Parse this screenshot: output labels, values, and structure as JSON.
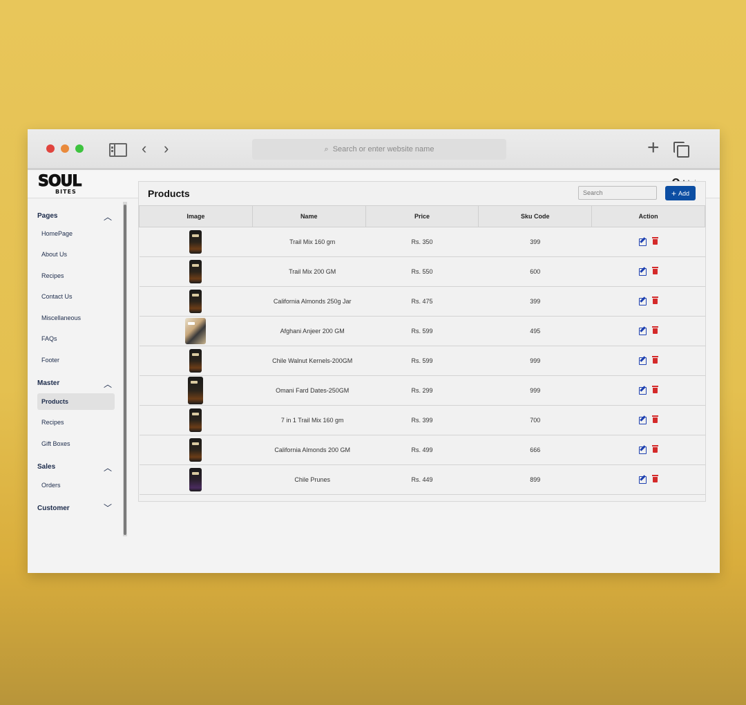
{
  "browser": {
    "url_placeholder": "Search or enter website name"
  },
  "header": {
    "logo_text": "SOUL BITES",
    "user_label": "Admin"
  },
  "sidebar": {
    "sections": [
      {
        "title": "Pages",
        "expanded": true,
        "items": [
          "HomePage",
          "About Us",
          "Recipes",
          "Contact Us",
          "Miscellaneous",
          "FAQs",
          "Footer"
        ]
      },
      {
        "title": "Master",
        "expanded": true,
        "items": [
          "Products",
          "Recipes",
          "Gift Boxes"
        ],
        "active": "Products"
      },
      {
        "title": "Sales",
        "expanded": true,
        "items": [
          "Orders"
        ]
      },
      {
        "title": "Customer",
        "expanded": false,
        "items": []
      }
    ]
  },
  "main": {
    "title": "Products",
    "search_placeholder": "Search",
    "add_label": "Add",
    "columns": [
      "Image",
      "Name",
      "Price",
      "Sku Code",
      "Action"
    ],
    "rows": [
      {
        "name": "Trail Mix 160 gm",
        "price": "Rs. 350",
        "sku": "399",
        "thumb": "dark"
      },
      {
        "name": "Trail Mix 200 GM",
        "price": "Rs. 550",
        "sku": "600",
        "thumb": "dark"
      },
      {
        "name": "California Almonds 250g Jar",
        "price": "Rs. 475",
        "sku": "399",
        "thumb": "dark"
      },
      {
        "name": "Afghani Anjeer 200 GM",
        "price": "Rs. 599",
        "sku": "495",
        "thumb": "light"
      },
      {
        "name": "Chile Walnut Kernels-200GM",
        "price": "Rs. 599",
        "sku": "999",
        "thumb": "dark"
      },
      {
        "name": "Omani Fard Dates-250GM",
        "price": "Rs. 299",
        "sku": "999",
        "thumb": "dark"
      },
      {
        "name": "7 in 1 Trail Mix 160 gm",
        "price": "Rs. 399",
        "sku": "700",
        "thumb": "dark"
      },
      {
        "name": "California Almonds 200 GM",
        "price": "Rs. 499",
        "sku": "666",
        "thumb": "dark"
      },
      {
        "name": "Chile Prunes",
        "price": "Rs. 449",
        "sku": "899",
        "thumb": "purple"
      }
    ]
  },
  "colors": {
    "accent": "#0c4ea3",
    "edit": "#1c3fb0",
    "delete": "#d42a2a",
    "nav_text": "#1b2a4a"
  }
}
